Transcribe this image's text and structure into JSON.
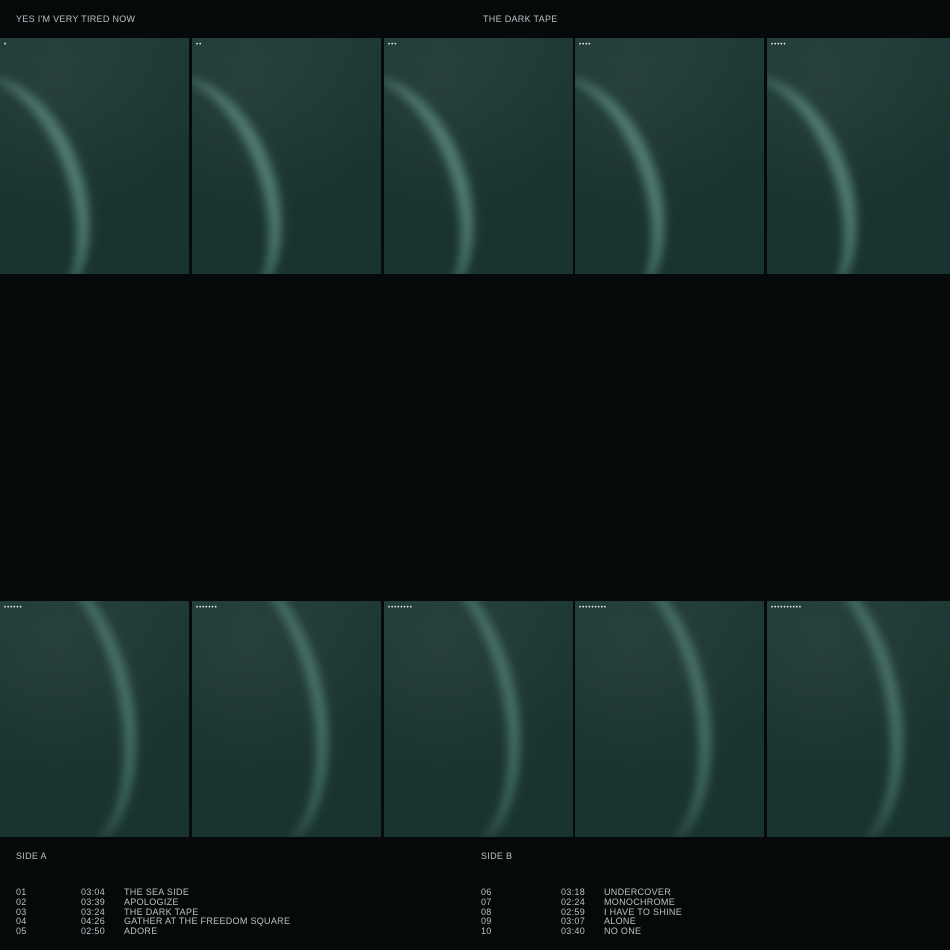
{
  "header": {
    "artist": "YES I'M VERY TIRED NOW",
    "album": "THE DARK TAPE"
  },
  "panels": {
    "top": [
      {
        "marker": "•"
      },
      {
        "marker": "••"
      },
      {
        "marker": "•••"
      },
      {
        "marker": "••••"
      },
      {
        "marker": "•••••"
      }
    ],
    "bottom": [
      {
        "marker": "••••••"
      },
      {
        "marker": "•••••••"
      },
      {
        "marker": "••••••••"
      },
      {
        "marker": "•••••••••"
      },
      {
        "marker": "••••••••••"
      }
    ]
  },
  "side_a": {
    "label": "SIDE A",
    "tracks": [
      {
        "num": "01",
        "duration": "03:04",
        "title": "THE SEA SIDE"
      },
      {
        "num": "02",
        "duration": "03:39",
        "title": "APOLOGIZE"
      },
      {
        "num": "03",
        "duration": "03:24",
        "title": "THE DARK TAPE"
      },
      {
        "num": "04",
        "duration": "04:26",
        "title": "GATHER AT THE FREEDOM SQUARE"
      },
      {
        "num": "05",
        "duration": "02:50",
        "title": "ADORE"
      }
    ]
  },
  "side_b": {
    "label": "SIDE B",
    "tracks": [
      {
        "num": "06",
        "duration": "03:18",
        "title": "UNDERCOVER"
      },
      {
        "num": "07",
        "duration": "02:24",
        "title": "MONOCHROME"
      },
      {
        "num": "08",
        "duration": "02:59",
        "title": "I HAVE TO SHINE"
      },
      {
        "num": "09",
        "duration": "03:07",
        "title": "ALONE"
      },
      {
        "num": "10",
        "duration": "03:40",
        "title": "NO ONE"
      }
    ]
  },
  "colors": {
    "background": "#05090a",
    "panel": "#1c3633",
    "text": "#b9c3c2"
  }
}
